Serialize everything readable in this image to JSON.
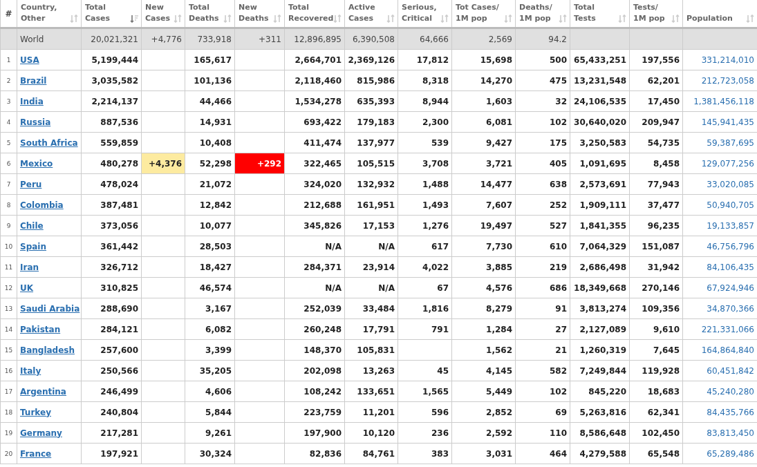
{
  "table": {
    "columns": [
      {
        "label": "#"
      },
      {
        "label": "Country,\nOther",
        "sortable": true,
        "selected": false
      },
      {
        "label": "Total\nCases",
        "sortable": true,
        "selected": true
      },
      {
        "label": "New\nCases",
        "sortable": true,
        "selected": false
      },
      {
        "label": "Total\nDeaths",
        "sortable": true,
        "selected": false
      },
      {
        "label": "New\nDeaths",
        "sortable": true,
        "selected": false
      },
      {
        "label": "Total\nRecovered",
        "sortable": true,
        "selected": false
      },
      {
        "label": "Active\nCases",
        "sortable": true,
        "selected": false
      },
      {
        "label": "Serious,\nCritical",
        "sortable": true,
        "selected": false
      },
      {
        "label": "Tot Cases/\n1M pop",
        "sortable": true,
        "selected": false
      },
      {
        "label": "Deaths/\n1M pop",
        "sortable": true,
        "selected": false
      },
      {
        "label": "Total\nTests",
        "sortable": true,
        "selected": false
      },
      {
        "label": "Tests/\n1M pop",
        "sortable": true,
        "selected": false
      },
      {
        "label": "Population",
        "sortable": true,
        "selected": false
      }
    ],
    "world_row": {
      "cells": [
        "",
        "World",
        "20,021,321",
        "+4,776",
        "733,918",
        "+311",
        "12,896,895",
        "6,390,508",
        "64,666",
        "2,569",
        "94.2",
        "",
        "",
        ""
      ]
    },
    "rows": [
      {
        "cells": [
          "1",
          "USA",
          "5,199,444",
          "",
          "165,617",
          "",
          "2,664,701",
          "2,369,126",
          "17,812",
          "15,698",
          "500",
          "65,433,251",
          "197,556",
          "331,214,010"
        ]
      },
      {
        "cells": [
          "2",
          "Brazil",
          "3,035,582",
          "",
          "101,136",
          "",
          "2,118,460",
          "815,986",
          "8,318",
          "14,270",
          "475",
          "13,231,548",
          "62,201",
          "212,723,058"
        ]
      },
      {
        "cells": [
          "3",
          "India",
          "2,214,137",
          "",
          "44,466",
          "",
          "1,534,278",
          "635,393",
          "8,944",
          "1,603",
          "32",
          "24,106,535",
          "17,450",
          "1,381,456,118"
        ]
      },
      {
        "cells": [
          "4",
          "Russia",
          "887,536",
          "",
          "14,931",
          "",
          "693,422",
          "179,183",
          "2,300",
          "6,081",
          "102",
          "30,640,020",
          "209,947",
          "145,941,435"
        ]
      },
      {
        "cells": [
          "5",
          "South Africa",
          "559,859",
          "",
          "10,408",
          "",
          "411,474",
          "137,977",
          "539",
          "9,427",
          "175",
          "3,250,583",
          "54,735",
          "59,387,695"
        ]
      },
      {
        "cells": [
          "6",
          "Mexico",
          "480,278",
          "+4,376",
          "52,298",
          "+292",
          "322,465",
          "105,515",
          "3,708",
          "3,721",
          "405",
          "1,091,695",
          "8,458",
          "129,077,256"
        ]
      },
      {
        "cells": [
          "7",
          "Peru",
          "478,024",
          "",
          "21,072",
          "",
          "324,020",
          "132,932",
          "1,488",
          "14,477",
          "638",
          "2,573,691",
          "77,943",
          "33,020,085"
        ]
      },
      {
        "cells": [
          "8",
          "Colombia",
          "387,481",
          "",
          "12,842",
          "",
          "212,688",
          "161,951",
          "1,493",
          "7,607",
          "252",
          "1,909,111",
          "37,477",
          "50,940,705"
        ]
      },
      {
        "cells": [
          "9",
          "Chile",
          "373,056",
          "",
          "10,077",
          "",
          "345,826",
          "17,153",
          "1,276",
          "19,497",
          "527",
          "1,841,355",
          "96,235",
          "19,133,857"
        ]
      },
      {
        "cells": [
          "10",
          "Spain",
          "361,442",
          "",
          "28,503",
          "",
          "N/A",
          "N/A",
          "617",
          "7,730",
          "610",
          "7,064,329",
          "151,087",
          "46,756,796"
        ]
      },
      {
        "cells": [
          "11",
          "Iran",
          "326,712",
          "",
          "18,427",
          "",
          "284,371",
          "23,914",
          "4,022",
          "3,885",
          "219",
          "2,686,498",
          "31,942",
          "84,106,435"
        ]
      },
      {
        "cells": [
          "12",
          "UK",
          "310,825",
          "",
          "46,574",
          "",
          "N/A",
          "N/A",
          "67",
          "4,576",
          "686",
          "18,349,668",
          "270,146",
          "67,924,946"
        ]
      },
      {
        "cells": [
          "13",
          "Saudi Arabia",
          "288,690",
          "",
          "3,167",
          "",
          "252,039",
          "33,484",
          "1,816",
          "8,279",
          "91",
          "3,813,274",
          "109,356",
          "34,870,366"
        ]
      },
      {
        "cells": [
          "14",
          "Pakistan",
          "284,121",
          "",
          "6,082",
          "",
          "260,248",
          "17,791",
          "791",
          "1,284",
          "27",
          "2,127,089",
          "9,610",
          "221,331,066"
        ]
      },
      {
        "cells": [
          "15",
          "Bangladesh",
          "257,600",
          "",
          "3,399",
          "",
          "148,370",
          "105,831",
          "",
          "1,562",
          "21",
          "1,260,319",
          "7,645",
          "164,864,840"
        ]
      },
      {
        "cells": [
          "16",
          "Italy",
          "250,566",
          "",
          "35,205",
          "",
          "202,098",
          "13,263",
          "45",
          "4,145",
          "582",
          "7,249,844",
          "119,928",
          "60,451,842"
        ]
      },
      {
        "cells": [
          "17",
          "Argentina",
          "246,499",
          "",
          "4,606",
          "",
          "108,242",
          "133,651",
          "1,565",
          "5,449",
          "102",
          "845,220",
          "18,683",
          "45,240,280"
        ]
      },
      {
        "cells": [
          "18",
          "Turkey",
          "240,804",
          "",
          "5,844",
          "",
          "223,759",
          "11,201",
          "596",
          "2,852",
          "69",
          "5,263,816",
          "62,341",
          "84,435,766"
        ]
      },
      {
        "cells": [
          "19",
          "Germany",
          "217,281",
          "",
          "9,261",
          "",
          "197,900",
          "10,120",
          "236",
          "2,592",
          "110",
          "8,586,648",
          "102,450",
          "83,813,450"
        ]
      },
      {
        "cells": [
          "20",
          "France",
          "197,921",
          "",
          "30,324",
          "",
          "82,836",
          "84,761",
          "383",
          "3,031",
          "464",
          "4,279,588",
          "65,548",
          "65,289,486"
        ]
      }
    ]
  }
}
